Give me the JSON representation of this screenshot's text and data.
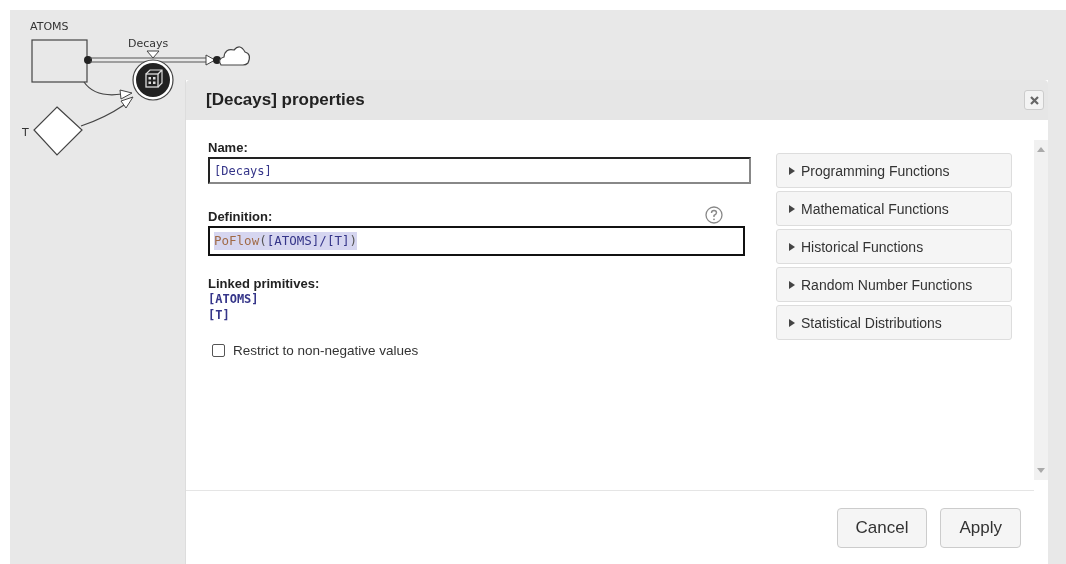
{
  "diagram": {
    "stock": {
      "label": "ATOMS"
    },
    "flow": {
      "label": "Decays"
    },
    "variable": {
      "label": "T"
    }
  },
  "dialog": {
    "title": "[Decays] properties",
    "name_field": {
      "label": "Name:",
      "value": "[Decays]"
    },
    "definition_field": {
      "label": "Definition:",
      "tokens": [
        {
          "text": "PoFlow",
          "kind": "function"
        },
        {
          "text": "(",
          "kind": "punct"
        },
        {
          "text": "[ATOMS]/[T]",
          "kind": "reference"
        },
        {
          "text": ")",
          "kind": "punct"
        }
      ]
    },
    "linked_primitives": {
      "label": "Linked primitives:",
      "items": [
        "[ATOMS]",
        "[T]"
      ]
    },
    "restrict_checkbox": {
      "label": "Restrict to non-negative values",
      "checked": false
    },
    "function_groups": [
      {
        "label": "Programming Functions",
        "expanded": false
      },
      {
        "label": "Mathematical Functions",
        "expanded": false
      },
      {
        "label": "Historical Functions",
        "expanded": false
      },
      {
        "label": "Random Number Functions",
        "expanded": false
      },
      {
        "label": "Statistical Distributions",
        "expanded": false
      }
    ],
    "buttons": [
      "Cancel",
      "Apply"
    ]
  }
}
